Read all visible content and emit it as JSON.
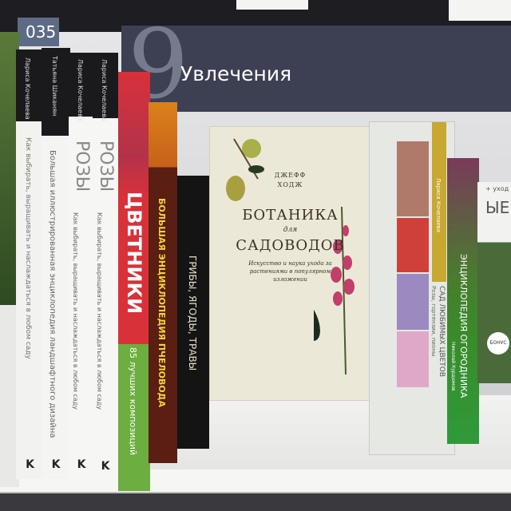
{
  "sign": {
    "number": "9",
    "label": "Увлечения",
    "tag": "035"
  },
  "spines": [
    {
      "author": "Лариса Кочелаева",
      "title": "РОЗЫ",
      "subtitle": "Как выбирать, выращивать и наслаждаться в любом саду"
    },
    {
      "author": "Татьяна Шиканян",
      "title": "Большая иллюстрированная энциклопедия ландшафтного дизайна"
    },
    {
      "author": "Лариса Кочелаева",
      "title": "РОЗЫ",
      "subtitle": "Как выбирать, выращивать и наслаждаться в любом саду"
    },
    {
      "author": "Лариса Кочелаева",
      "title": "РОЗЫ",
      "subtitle": "Как выбирать, выращивать и наслаждаться в любом саду"
    },
    {
      "title": "ЦВЕТНИКИ",
      "subtitle": "85 лучших композиций"
    },
    {
      "title": "БОЛЬШАЯ ЭНЦИКЛОПЕДИЯ ПЧЕЛОВОДА"
    },
    {
      "title": "ГРИБЫ, ЯГОДЫ, ТРАВЫ"
    }
  ],
  "front_cover": {
    "author_line1": "ДЖЕФФ",
    "author_line2": "ХОДЖ",
    "title_line1": "БОТАНИКА",
    "title_connector": "для",
    "title_line2": "САДОВОДОВ",
    "subtitle": "Искусство и наука ухода за растениями в популярном изложении"
  },
  "right_books": {
    "open_book_spine_author": "Лариса Кочелаева",
    "open_book_spine_title": "САД ЛЮБИМЫХ ЦВЕТОВ",
    "open_book_spine_subtitle": "Розы, гортензии, пионы",
    "green_spine_author": "Николай Курдюмов",
    "green_spine_title": "ЭНЦИКЛОПЕДИЯ ОГОРОДНИКА",
    "back_book_top": "+ уход",
    "back_book_title": "ЫЕ",
    "badge": "БОНУС"
  },
  "colors": {
    "sign": "#3d3f52",
    "red_spine": "#d8313a",
    "green_spine": "#4a9a3a",
    "bee_spine": "#5a1e12"
  }
}
